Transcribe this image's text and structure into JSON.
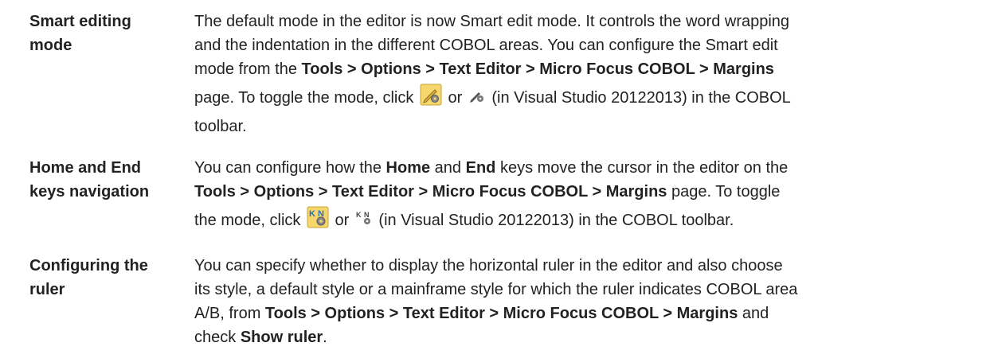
{
  "sections": [
    {
      "term_lines": [
        "Smart editing",
        "mode"
      ],
      "desc": {
        "line1": "The default mode in the editor is now Smart edit mode. It controls the word wrapping",
        "line2": "and the indentation in the different COBOL areas. You can configure the Smart edit",
        "line3_pre": "mode from the ",
        "line3_bold": "Tools > Options > Text Editor > Micro Focus COBOL > Margins",
        "line4_pre": "page. To toggle the mode, click ",
        "line4_or": " or ",
        "line4_post": " (in Visual Studio 20122013) in the COBOL",
        "line5": "toolbar.",
        "icon1": "smart-edit-toggle-icon",
        "icon2": "smart-edit-toggle-2012-icon"
      }
    },
    {
      "term_lines": [
        "Home and End",
        "keys navigation"
      ],
      "desc": {
        "line1_pre": "You can configure how the ",
        "line1_bold1": "Home",
        "line1_mid": " and ",
        "line1_bold2": "End",
        "line1_post": " keys move the cursor in the editor on the",
        "line2_bold": "Tools > Options > Text Editor > Micro Focus COBOL > Margins",
        "line2_post": " page. To toggle",
        "line3_pre": "the mode, click ",
        "line3_or": " or ",
        "line3_post": " (in Visual Studio 20122013) in the COBOL toolbar.",
        "icon1": "home-end-toggle-icon",
        "icon2": "home-end-toggle-2012-icon"
      }
    },
    {
      "term_lines": [
        "Configuring the",
        "ruler"
      ],
      "desc": {
        "line1": "You can specify whether to display the horizontal ruler in the editor and also choose",
        "line2": "its style, a default style or a mainframe style for which the ruler indicates COBOL area",
        "line3_pre": "A/B, from ",
        "line3_bold": "Tools > Options > Text Editor > Micro Focus COBOL > Margins",
        "line3_post": " and",
        "line4_pre": "check ",
        "line4_bold": "Show ruler",
        "line4_post": "."
      }
    }
  ],
  "colors": {
    "text": "#222222",
    "icon_bg": "#f5d76e",
    "icon_accent": "#2e6fb5"
  }
}
